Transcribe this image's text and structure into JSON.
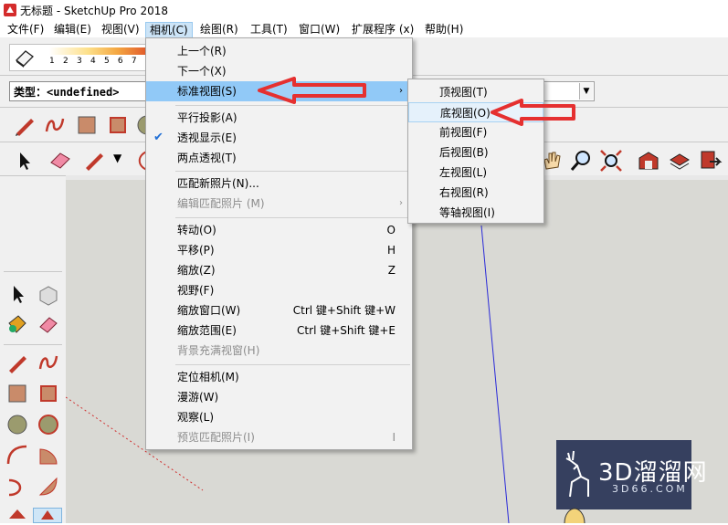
{
  "window": {
    "title": "无标题 - SketchUp Pro 2018"
  },
  "menubar": {
    "items": [
      {
        "label": "文件(F)"
      },
      {
        "label": "编辑(E)"
      },
      {
        "label": "视图(V)"
      },
      {
        "label": "相机(C)"
      },
      {
        "label": "绘图(R)"
      },
      {
        "label": "工具(T)"
      },
      {
        "label": "窗口(W)"
      },
      {
        "label": "扩展程序 (x)"
      },
      {
        "label": "帮助(H)"
      }
    ]
  },
  "toolbar": {
    "scale_numbers": "1 2 3 4 5 6 7 8 9",
    "type_field": "类型：<undefined>"
  },
  "camera_menu": {
    "items": [
      {
        "label": "上一个(R)"
      },
      {
        "label": "下一个(X)"
      },
      {
        "label": "标准视图(S)"
      },
      {
        "label": "平行投影(A)"
      },
      {
        "label": "透视显示(E)"
      },
      {
        "label": "两点透视(T)"
      },
      {
        "label": "匹配新照片(N)..."
      },
      {
        "label": "编辑匹配照片 (M)"
      },
      {
        "label": "转动(O)",
        "shortcut": "O"
      },
      {
        "label": "平移(P)",
        "shortcut": "H"
      },
      {
        "label": "缩放(Z)",
        "shortcut": "Z"
      },
      {
        "label": "视野(F)"
      },
      {
        "label": "缩放窗口(W)",
        "shortcut": "Ctrl 键+Shift 键+W"
      },
      {
        "label": "缩放范围(E)",
        "shortcut": "Ctrl 键+Shift 键+E"
      },
      {
        "label": "背景充满视窗(H)"
      },
      {
        "label": "定位相机(M)"
      },
      {
        "label": "漫游(W)"
      },
      {
        "label": "观察(L)"
      },
      {
        "label": "预览匹配照片(I)",
        "shortcut": "I"
      }
    ]
  },
  "standard_views_menu": {
    "items": [
      {
        "label": "顶视图(T)"
      },
      {
        "label": "底视图(O)"
      },
      {
        "label": "前视图(F)"
      },
      {
        "label": "后视图(B)"
      },
      {
        "label": "左视图(L)"
      },
      {
        "label": "右视图(R)"
      },
      {
        "label": "等轴视图(I)"
      }
    ]
  },
  "watermark": {
    "main": "3D溜溜网",
    "sub": "3D66.COM"
  },
  "colors": {
    "accent_arrow": "#e53030",
    "menu_highlight": "#91c9f7",
    "checkmark": "#2270d6"
  }
}
